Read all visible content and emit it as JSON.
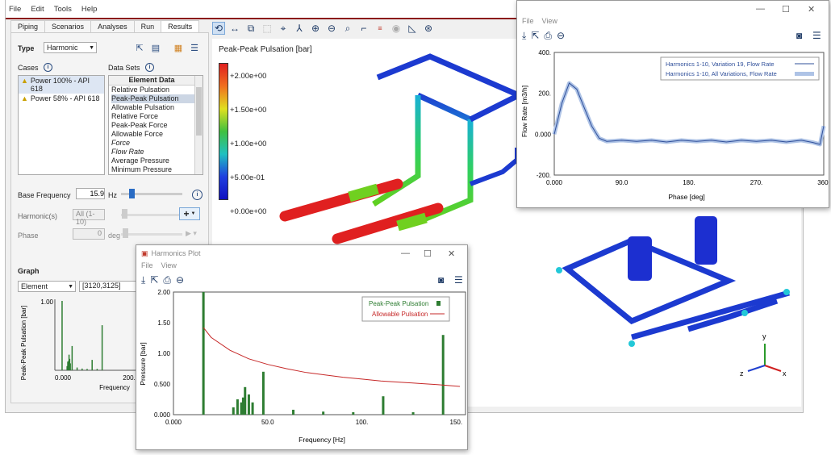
{
  "menubar": {
    "items": [
      "File",
      "Edit",
      "Tools",
      "Help"
    ]
  },
  "tabs": [
    "Piping",
    "Scenarios",
    "Analyses",
    "Run",
    "Results"
  ],
  "left": {
    "type_label": "Type",
    "type_value": "Harmonic",
    "cases_label": "Cases",
    "datasets_label": "Data Sets",
    "cases": [
      "Power 100% - API 618",
      "Power 58% - API 618"
    ],
    "element_data_header": "Element Data",
    "element_data": [
      "Relative Pulsation",
      "Peak-Peak Pulsation",
      "Allowable Pulsation",
      "Relative Force",
      "Peak-Peak Force",
      "Allowable Force",
      "Force",
      "Flow Rate",
      "Average Pressure",
      "Minimum Pressure"
    ],
    "base_freq_label": "Base Frequency",
    "base_freq_value": "15.9",
    "base_freq_unit": "Hz",
    "harmonics_label": "Harmonic(s)",
    "harmonics_value": "All (1-10)",
    "phase_label": "Phase",
    "phase_value": "0",
    "phase_unit": "deg",
    "graph_label": "Graph",
    "graph_select": "Element",
    "graph_range": "[3120,3125]",
    "mini_ylabel": "Peak-Peak Pulsation [bar]",
    "mini_xlabel": "Frequency",
    "mini_y_top": "1.00",
    "mini_x_ticks": [
      "0.000",
      "200."
    ]
  },
  "view": {
    "title": "Peak-Peak Pulsation [bar]",
    "scale": [
      "+2.00e+00",
      "+1.50e+00",
      "+1.00e+00",
      "+5.00e-01",
      "+0.00e+00"
    ],
    "axes": {
      "x": "x",
      "y": "y",
      "z": "z"
    }
  },
  "harm_win": {
    "title": "Harmonics Plot",
    "menu": [
      "File",
      "View"
    ],
    "legend": [
      "Peak-Peak Pulsation",
      "Allowable Pulsation"
    ],
    "ylabel": "Pressure [bar]",
    "xlabel": "Frequency [Hz]",
    "yticks": [
      "2.00",
      "1.50",
      "1.00",
      "0.500",
      "0.000"
    ],
    "xticks": [
      "0.000",
      "50.0",
      "100.",
      "150."
    ],
    "colors": {
      "bars": "#2e7d32",
      "allowable": "#c62828"
    }
  },
  "flow_win": {
    "menu": [
      "File",
      "View"
    ],
    "legend": [
      "Harmonics 1-10, Variation 19, Flow Rate",
      "Harmonics 1-10, All Variations, Flow Rate"
    ],
    "ylabel": "Flow Rate [m3/h]",
    "xlabel": "Phase [deg]",
    "yticks": [
      "400.",
      "200.",
      "0.000",
      "-200."
    ],
    "xticks": [
      "0.000",
      "90.0",
      "180.",
      "270.",
      "360."
    ],
    "colors": {
      "line": "#2f4f9a"
    }
  },
  "chart_data": [
    {
      "type": "bar",
      "title": "",
      "xlabel": "Frequency [Hz]",
      "ylabel": "Pressure [bar]",
      "xlim": [
        0,
        155
      ],
      "ylim": [
        0,
        2
      ],
      "series": [
        {
          "name": "Peak-Peak Pulsation",
          "x": [
            15.9,
            31.8,
            34,
            36,
            37,
            38,
            40,
            42,
            47.7,
            63.6,
            79.5,
            95.4,
            111.3,
            127.2,
            143.1
          ],
          "values": [
            2.0,
            0.12,
            0.25,
            0.2,
            0.28,
            0.45,
            0.33,
            0.2,
            0.7,
            0.08,
            0.05,
            0.04,
            0.3,
            0.04,
            1.3
          ]
        },
        {
          "name": "Allowable Pulsation",
          "x": [
            15.9,
            20,
            30,
            40,
            50,
            60,
            70,
            80,
            90,
            100,
            110,
            120,
            130,
            140,
            152
          ],
          "values": [
            1.42,
            1.26,
            1.05,
            0.91,
            0.82,
            0.75,
            0.69,
            0.65,
            0.61,
            0.58,
            0.55,
            0.53,
            0.51,
            0.49,
            0.46
          ]
        }
      ]
    },
    {
      "type": "line",
      "title": "",
      "xlabel": "Phase [deg]",
      "ylabel": "Flow Rate [m3/h]",
      "xlim": [
        0,
        360
      ],
      "ylim": [
        -200,
        400
      ],
      "series": [
        {
          "name": "Harmonics 1-10, Variation 19, Flow Rate",
          "x": [
            0,
            10,
            20,
            30,
            40,
            50,
            60,
            70,
            90,
            110,
            130,
            150,
            170,
            190,
            210,
            230,
            250,
            270,
            290,
            310,
            330,
            345,
            355,
            360
          ],
          "values": [
            0,
            150,
            250,
            220,
            130,
            40,
            -20,
            -35,
            -30,
            -35,
            -30,
            -38,
            -30,
            -35,
            -30,
            -38,
            -30,
            -35,
            -30,
            -38,
            -30,
            -40,
            -50,
            40
          ]
        }
      ]
    }
  ]
}
